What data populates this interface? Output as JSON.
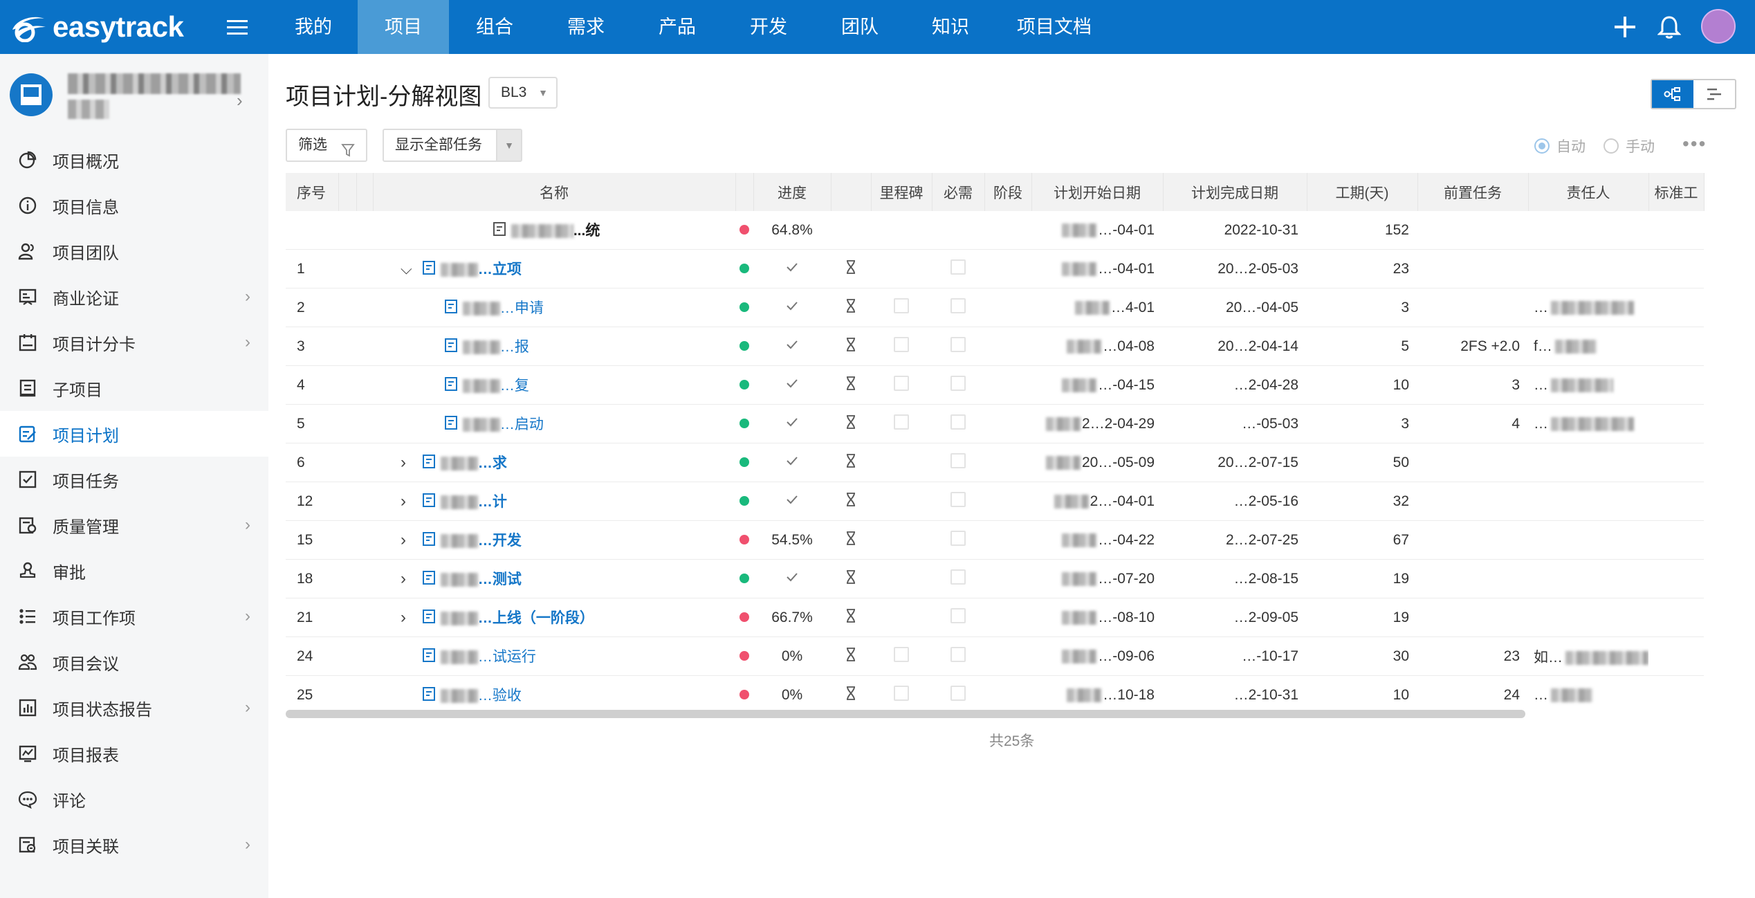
{
  "app": {
    "brand": "easytrack"
  },
  "nav": {
    "items": [
      "我的",
      "项目",
      "组合",
      "需求",
      "产品",
      "开发",
      "团队",
      "知识",
      "项目文档"
    ],
    "active_index": 1
  },
  "sidebar": {
    "items": [
      {
        "label": "项目概况",
        "icon": "pie-chart-icon",
        "chevron": false
      },
      {
        "label": "项目信息",
        "icon": "info-icon",
        "chevron": false
      },
      {
        "label": "项目团队",
        "icon": "team-icon",
        "chevron": false
      },
      {
        "label": "商业论证",
        "icon": "business-case-icon",
        "chevron": true
      },
      {
        "label": "项目计分卡",
        "icon": "scorecard-icon",
        "chevron": true
      },
      {
        "label": "子项目",
        "icon": "subproject-icon",
        "chevron": false
      },
      {
        "label": "项目计划",
        "icon": "plan-icon",
        "chevron": false,
        "active": true
      },
      {
        "label": "项目任务",
        "icon": "task-icon",
        "chevron": false
      },
      {
        "label": "质量管理",
        "icon": "quality-icon",
        "chevron": true
      },
      {
        "label": "审批",
        "icon": "approval-icon",
        "chevron": false
      },
      {
        "label": "项目工作项",
        "icon": "workitem-icon",
        "chevron": true
      },
      {
        "label": "项目会议",
        "icon": "meeting-icon",
        "chevron": false
      },
      {
        "label": "项目状态报告",
        "icon": "status-report-icon",
        "chevron": true
      },
      {
        "label": "项目报表",
        "icon": "report-icon",
        "chevron": false
      },
      {
        "label": "评论",
        "icon": "comment-icon",
        "chevron": false
      },
      {
        "label": "项目关联",
        "icon": "link-icon",
        "chevron": true
      }
    ]
  },
  "main": {
    "title": "项目计划-分解视图",
    "baseline": "BL3",
    "filter_label": "筛选",
    "show_all_label": "显示全部任务",
    "mode_auto": "自动",
    "mode_manual": "手动",
    "mode_selected": "自动",
    "total": "共25条"
  },
  "table": {
    "columns": [
      "序号",
      "名称",
      "进度",
      "里程碑",
      "必需",
      "阶段",
      "计划开始日期",
      "计划完成日期",
      "工期(天)",
      "前置任务",
      "责任人",
      "标准工"
    ],
    "rows": [
      {
        "seq": "",
        "name": "...统",
        "name_level": 0,
        "bold": true,
        "root": true,
        "status": "red",
        "progress": "64.8%",
        "done": false,
        "hourglass": false,
        "milestone": false,
        "required": false,
        "start": "…-04-01",
        "end": "2022-10-31",
        "days": "152",
        "pred": "",
        "owner": ""
      },
      {
        "seq": "1",
        "name": "…立项",
        "name_level": 1,
        "bold": true,
        "expand": "open",
        "status": "green",
        "progress": "",
        "done": true,
        "hourglass": true,
        "milestone": false,
        "required": true,
        "start": "…-04-01",
        "end": "20…2-05-03",
        "days": "23",
        "pred": "",
        "owner": ""
      },
      {
        "seq": "2",
        "name": "…申请",
        "name_level": 2,
        "bold": false,
        "status": "green",
        "progress": "",
        "done": true,
        "hourglass": true,
        "milestone": true,
        "required": true,
        "start": "…4-01",
        "end": "20…-04-05",
        "days": "3",
        "pred": "",
        "owner": "…"
      },
      {
        "seq": "3",
        "name": "…报",
        "name_level": 2,
        "bold": false,
        "status": "green",
        "progress": "",
        "done": true,
        "hourglass": true,
        "milestone": true,
        "required": true,
        "start": "…04-08",
        "end": "20…2-04-14",
        "days": "5",
        "pred": "2FS +2.0",
        "owner": "f…"
      },
      {
        "seq": "4",
        "name": "…复",
        "name_level": 2,
        "bold": false,
        "status": "green",
        "progress": "",
        "done": true,
        "hourglass": true,
        "milestone": true,
        "required": true,
        "start": "…-04-15",
        "end": "…2-04-28",
        "days": "10",
        "pred": "3",
        "owner": "…"
      },
      {
        "seq": "5",
        "name": "…启动",
        "name_level": 2,
        "bold": false,
        "status": "green",
        "progress": "",
        "done": true,
        "hourglass": true,
        "milestone": true,
        "required": true,
        "start": "2…2-04-29",
        "end": "…-05-03",
        "days": "3",
        "pred": "4",
        "owner": "…"
      },
      {
        "seq": "6",
        "name": "…求",
        "name_level": 1,
        "bold": true,
        "expand": "closed",
        "status": "green",
        "progress": "",
        "done": true,
        "hourglass": true,
        "milestone": false,
        "required": true,
        "start": "20…-05-09",
        "end": "20…2-07-15",
        "days": "50",
        "pred": "",
        "owner": ""
      },
      {
        "seq": "12",
        "name": "…计",
        "name_level": 1,
        "bold": true,
        "expand": "closed",
        "status": "green",
        "progress": "",
        "done": true,
        "hourglass": true,
        "milestone": false,
        "required": true,
        "start": "2…-04-01",
        "end": "…2-05-16",
        "days": "32",
        "pred": "",
        "owner": ""
      },
      {
        "seq": "15",
        "name": "…开发",
        "name_level": 1,
        "bold": true,
        "expand": "closed",
        "status": "red",
        "progress": "54.5%",
        "done": false,
        "hourglass": true,
        "milestone": false,
        "required": true,
        "start": "…-04-22",
        "end": "2…2-07-25",
        "days": "67",
        "pred": "",
        "owner": ""
      },
      {
        "seq": "18",
        "name": "…测试",
        "name_level": 1,
        "bold": true,
        "expand": "closed",
        "status": "green",
        "progress": "",
        "done": true,
        "hourglass": true,
        "milestone": false,
        "required": true,
        "start": "…-07-20",
        "end": "…2-08-15",
        "days": "19",
        "pred": "",
        "owner": ""
      },
      {
        "seq": "21",
        "name": "…上线（一阶段）",
        "name_level": 1,
        "bold": true,
        "expand": "closed",
        "status": "red",
        "progress": "66.7%",
        "done": false,
        "hourglass": true,
        "milestone": false,
        "required": true,
        "start": "…-08-10",
        "end": "…2-09-05",
        "days": "19",
        "pred": "",
        "owner": ""
      },
      {
        "seq": "24",
        "name": "…试运行",
        "name_level": 1,
        "bold": false,
        "status": "red",
        "progress": "0%",
        "done": false,
        "hourglass": true,
        "milestone": true,
        "required": true,
        "start": "…-09-06",
        "end": "…-10-17",
        "days": "30",
        "pred": "23",
        "owner": "如…"
      },
      {
        "seq": "25",
        "name": "…验收",
        "name_level": 1,
        "bold": false,
        "status": "red",
        "progress": "0%",
        "done": false,
        "hourglass": true,
        "milestone": true,
        "required": true,
        "start": "…10-18",
        "end": "…2-10-31",
        "days": "10",
        "pred": "24",
        "owner": "…"
      }
    ]
  },
  "colors": {
    "brand": "#0a72c7",
    "nav_active": "#4a9bd6",
    "ok": "#19b97c",
    "warn": "#f0506e",
    "link": "#1677c8"
  }
}
